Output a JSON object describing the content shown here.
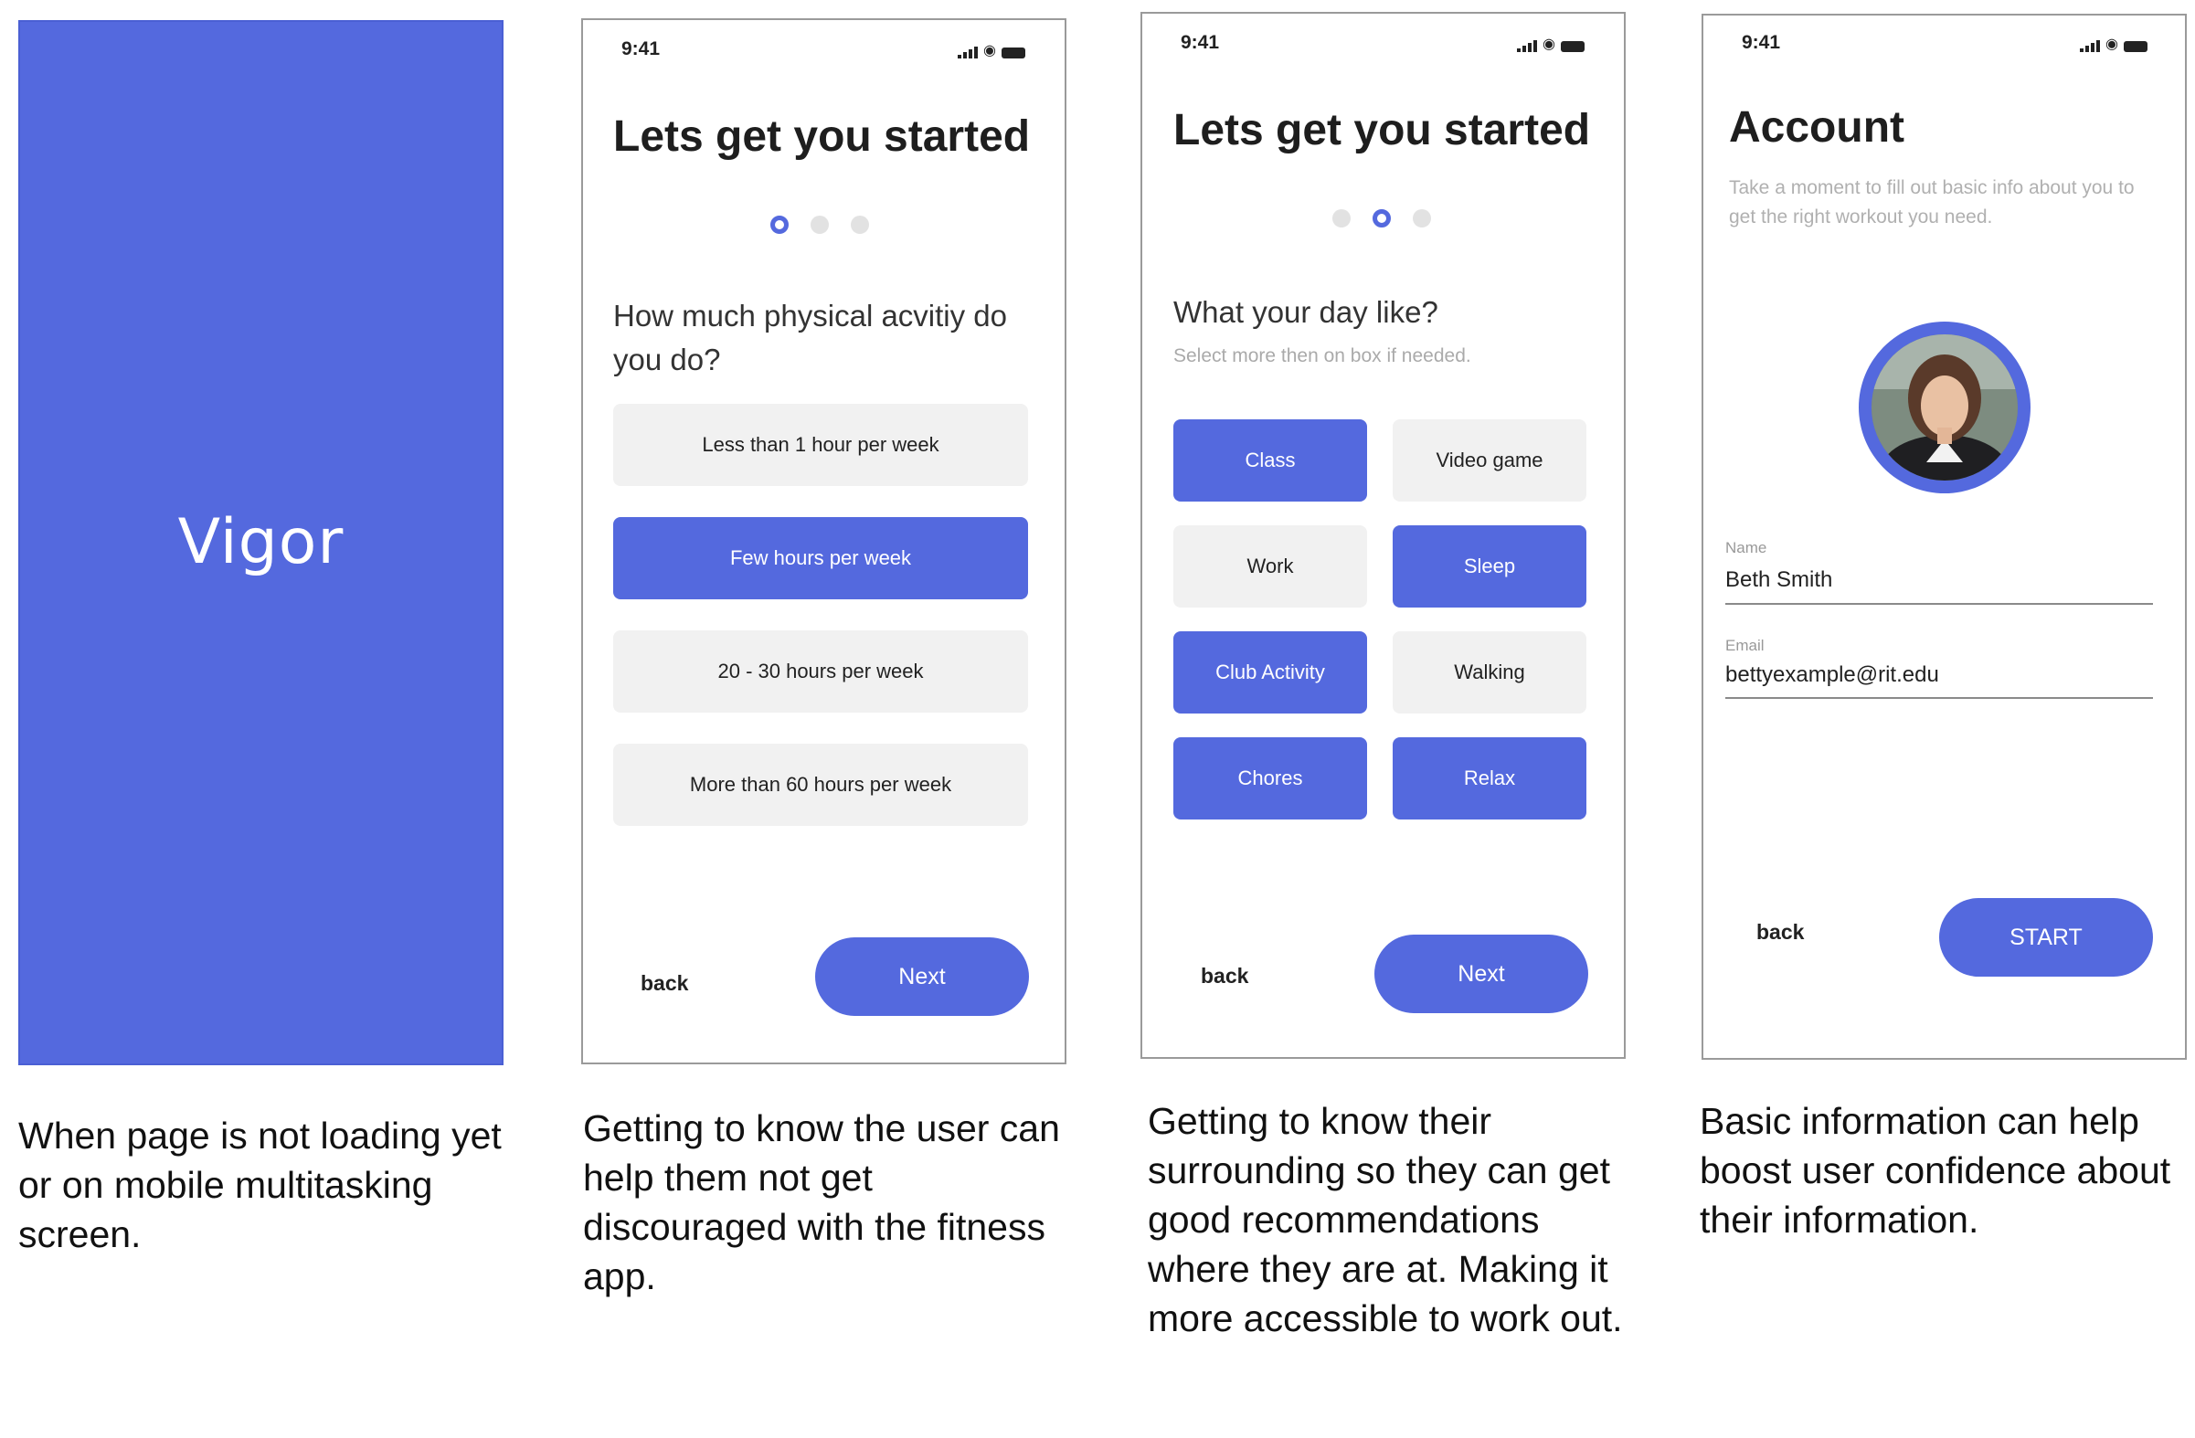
{
  "splash": {
    "logo": "Vigor"
  },
  "status_time": "9:41",
  "screen2": {
    "title": "Lets get you started",
    "question": "How much physical acvitiy do you do?",
    "options": [
      {
        "label": "Less than 1 hour per week",
        "selected": false
      },
      {
        "label": "Few hours per week",
        "selected": true
      },
      {
        "label": "20 - 30 hours per week",
        "selected": false
      },
      {
        "label": "More than 60 hours per week",
        "selected": false
      }
    ],
    "back": "back",
    "next": "Next"
  },
  "screen3": {
    "title": "Lets get you started",
    "question": "What your day like?",
    "subtitle": "Select more then on box if needed.",
    "options": [
      {
        "label": "Class",
        "selected": true
      },
      {
        "label": "Video game",
        "selected": false
      },
      {
        "label": "Work",
        "selected": false
      },
      {
        "label": "Sleep",
        "selected": true
      },
      {
        "label": "Club Activity",
        "selected": true
      },
      {
        "label": "Walking",
        "selected": false
      },
      {
        "label": "Chores",
        "selected": true
      },
      {
        "label": "Relax",
        "selected": true
      }
    ],
    "back": "back",
    "next": "Next"
  },
  "screen4": {
    "title": "Account",
    "description": "Take a moment to fill out basic info about you to get the right workout you need.",
    "name_label": "Name",
    "name_value": "Beth Smith",
    "email_label": "Email",
    "email_value": "bettyexample@rit.edu",
    "back": "back",
    "start": "START"
  },
  "captions": [
    "When page is not loading yet or on mobile multitasking screen.",
    "Getting to know the user can help them not get discouraged with the fitness app.",
    "Getting to know their surrounding so they can get good recommendations where they are at. Making it more accessible to work out.",
    "Basic information can help boost user confidence about their information."
  ],
  "colors": {
    "accent": "#5469DE",
    "option_bg": "#f1f1f1"
  },
  "icons": [
    "signal-icon",
    "wifi-icon",
    "battery-icon"
  ]
}
